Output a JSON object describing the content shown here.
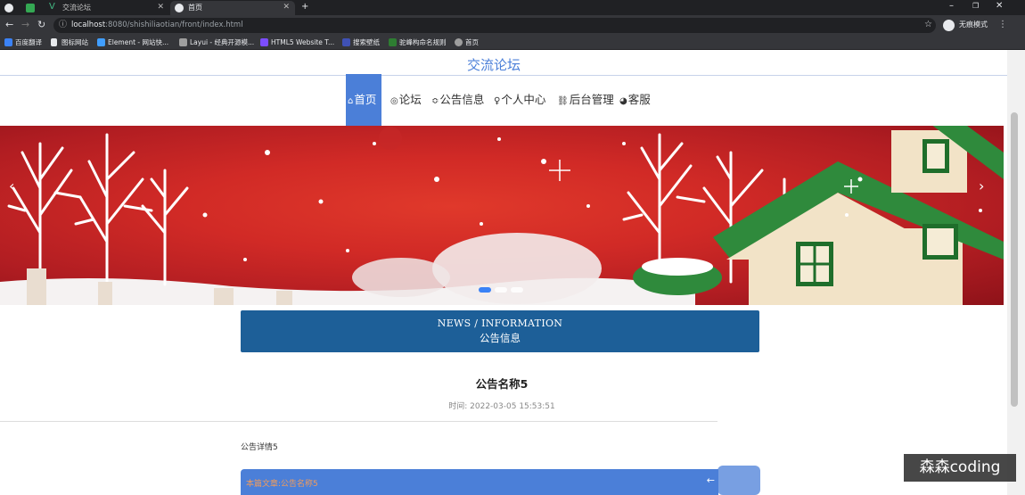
{
  "browser": {
    "tabs": [
      {
        "label": "",
        "icon": "globe-icon"
      },
      {
        "label": "",
        "icon": "app-icon"
      },
      {
        "label": "交流论坛",
        "icon": "vue-icon"
      },
      {
        "label": "首页",
        "icon": "globe-icon",
        "active": true
      }
    ],
    "new_tab": "+",
    "window_controls": {
      "minimize": "–",
      "restore": "❐",
      "close": "✕"
    },
    "url_host": "localhost",
    "url_rest": ":8080/shishiliaotian/front/index.html",
    "profile_label": "无痕模式",
    "bookmarks": [
      {
        "label": "百度翻译",
        "color": "#3b82f6"
      },
      {
        "label": "图标网站",
        "color": "#e8eaed"
      },
      {
        "label": "Element - 网站快...",
        "color": "#409eff"
      },
      {
        "label": "Layui - 经典开源模...",
        "color": "#9e9e9e"
      },
      {
        "label": "HTML5 Website T...",
        "color": "#7c4dff"
      },
      {
        "label": "搜索壁纸",
        "color": "#3f51b5"
      },
      {
        "label": "驼峰构命名规则",
        "color": "#2e7d32"
      },
      {
        "label": "首页",
        "color": "#9e9e9e"
      }
    ]
  },
  "site": {
    "title": "交流论坛",
    "nav": [
      {
        "label": "首页",
        "glyph": "⌂",
        "active": true
      },
      {
        "label": "论坛",
        "glyph": "◎"
      },
      {
        "label": "公告信息",
        "glyph": "≎"
      },
      {
        "label": "个人中心",
        "glyph": "♀"
      },
      {
        "label": "后台管理",
        "glyph": "⛓"
      },
      {
        "label": "客服",
        "glyph": "◕"
      }
    ],
    "banner_arrows": {
      "prev": "‹",
      "next": "›"
    }
  },
  "notice": {
    "header_en": "NEWS / INFORMATION",
    "header_cn": "公告信息",
    "title": "公告名称5",
    "time_label": "时间:",
    "time_value": "2022-03-05 15:53:51",
    "content": "公告详情5",
    "current_label": "本篇文章:",
    "current_title": "公告名称5",
    "back_glyph": "←"
  },
  "watermark": "森森coding",
  "colors": {
    "accent": "#4b7fd8",
    "header_blue": "#1d5f98",
    "banner_red": "#d12a26"
  }
}
